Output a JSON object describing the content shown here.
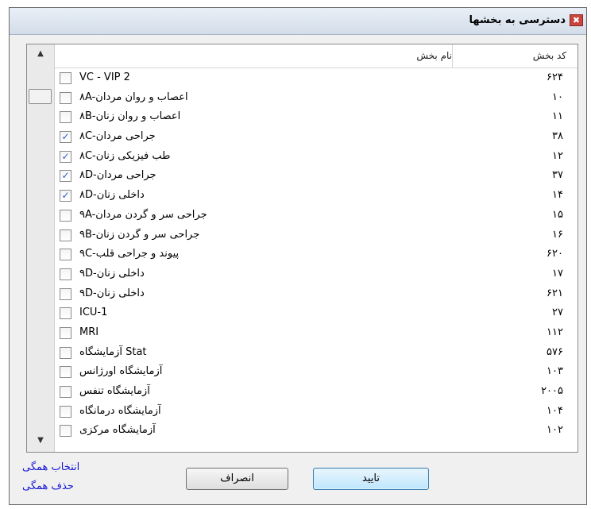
{
  "window": {
    "title": "دسترسی به بخشها",
    "close_glyph": "✖"
  },
  "table": {
    "col_name_header": "نام بخش",
    "col_code_header": "کد بخش",
    "rows": [
      {
        "name": "VC - VIP 2",
        "code": "۶۲۴",
        "checked": false
      },
      {
        "name": "۸A-اعصاب و روان مردان",
        "code": "۱۰",
        "checked": false
      },
      {
        "name": "۸B-اعصاب و روان زنان",
        "code": "۱۱",
        "checked": false
      },
      {
        "name": "۸C-جراحی مردان",
        "code": "۳۸",
        "checked": true
      },
      {
        "name": "۸C-طب فیزیکی زنان",
        "code": "۱۲",
        "checked": true
      },
      {
        "name": "۸D-جراحی مردان",
        "code": "۳۷",
        "checked": true
      },
      {
        "name": "۸D-داخلی زنان",
        "code": "۱۴",
        "checked": true
      },
      {
        "name": "۹A-جراحی سر و گردن مردان",
        "code": "۱۵",
        "checked": false
      },
      {
        "name": "۹B-جراحی سر و گردن زنان",
        "code": "۱۶",
        "checked": false
      },
      {
        "name": "۹C-پیوند و جراحی قلب",
        "code": "۶۲۰",
        "checked": false
      },
      {
        "name": "۹D-داخلی زنان",
        "code": "۱۷",
        "checked": false
      },
      {
        "name": "۹D-داخلی زنان",
        "code": "۶۲۱",
        "checked": false
      },
      {
        "name": "ICU-1",
        "code": "۲۷",
        "checked": false
      },
      {
        "name": "MRI",
        "code": "۱۱۲",
        "checked": false
      },
      {
        "name": "آزمایشگاه Stat",
        "code": "۵۷۶",
        "checked": false
      },
      {
        "name": "آزمایشگاه اورژانس",
        "code": "۱۰۳",
        "checked": false
      },
      {
        "name": "آزمایشگاه تنفس",
        "code": "۲۰۰۵",
        "checked": false
      },
      {
        "name": "آزمایشگاه درمانگاه",
        "code": "۱۰۴",
        "checked": false
      },
      {
        "name": "آزمایشگاه مرکزی",
        "code": "۱۰۲",
        "checked": false
      }
    ],
    "check_glyph": "✓",
    "scroll_up_glyph": "▲",
    "scroll_down_glyph": "▼",
    "sort_glyph": "▲"
  },
  "footer": {
    "select_all": "انتخاب همگی",
    "clear_all": "حذف همگی",
    "cancel": "انصراف",
    "ok": "تایید"
  }
}
